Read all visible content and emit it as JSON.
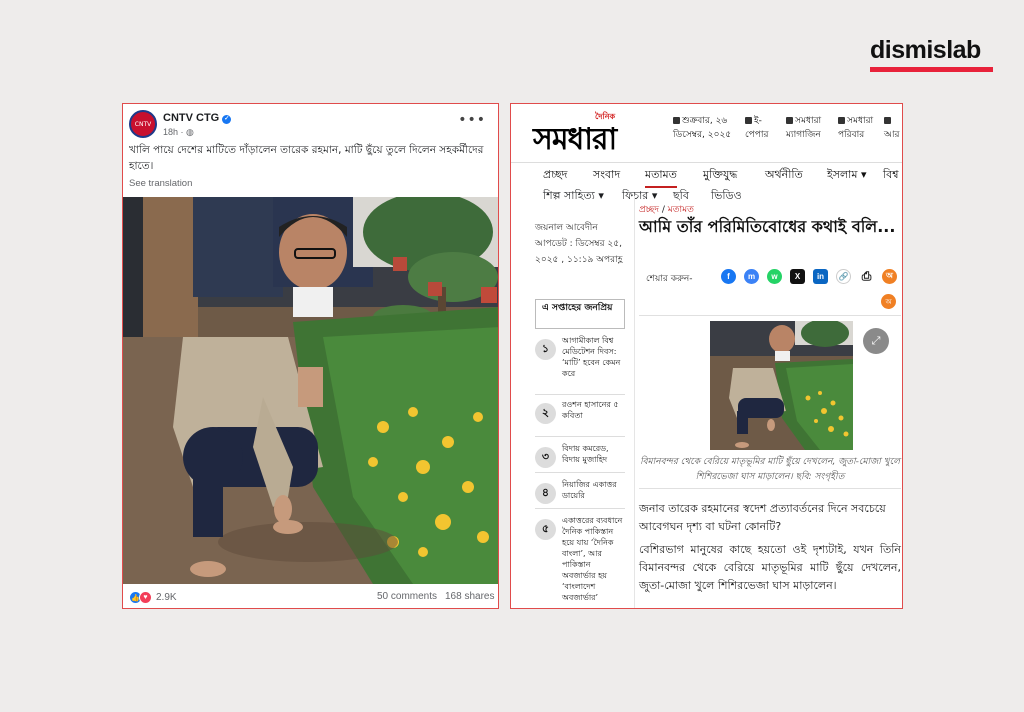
{
  "brand": {
    "name": "dismislab",
    "accent": "#e8223a"
  },
  "facebook_post": {
    "page_name": "CNTV CTG",
    "avatar_text": "CNTV",
    "verified": true,
    "time": "18h · ",
    "more": "•••",
    "text": "খালি পায়ে দেশের মাটিতে দাঁড়ালেন তারেক রহমান, মাটি ছুঁয়ে তুলে দিলেন সহকর্মীদের হাতে।",
    "see_translation": "See translation",
    "reactions": "2.9K",
    "comments": "50 comments",
    "shares": "168 shares"
  },
  "news_site": {
    "logo_tag": "দৈনিক",
    "logo": "সমধারা",
    "top_nav": [
      {
        "icon": "calendar-icon",
        "label": "শুক্রবার, ২৬ ডিসেম্বর, ২০২৫"
      },
      {
        "icon": "epaper-icon",
        "label": "ই-পেপার"
      },
      {
        "icon": "magazine-icon",
        "label": "সমধারা ম্যাগাজিন"
      },
      {
        "icon": "family-icon",
        "label": "সমধারা পরিবার"
      },
      {
        "icon": "more-icon",
        "label": "আর"
      }
    ],
    "main_nav": [
      "প্রচ্ছদ",
      "সংবাদ",
      "মতামত",
      "মুক্তিযুদ্ধ",
      "অর্থনীতি",
      "ইসলাম ▾",
      "বিশ্ব"
    ],
    "sub_nav": [
      "শিল্প সাহিত্য ▾",
      "ফিচার ▾",
      "ছবি",
      "ভিডিও"
    ],
    "breadcrumb": {
      "home": "প্রচ্ছদ",
      "sep": " / ",
      "section": "মতামত"
    },
    "author": "জয়নাল আবেদীন",
    "updated": "আপডেট : ডিসেম্বর ২৫, ২০২৫ , ১১:১৯ অপরাহ্ণ",
    "headline": "আমি তাঁর পরিমিতিবোধের কথাই বলি...",
    "share_label": "শেয়ার করুন-",
    "share_icons": [
      {
        "name": "facebook-icon",
        "glyph": "f",
        "color": "#1877f2"
      },
      {
        "name": "messenger-icon",
        "glyph": "m",
        "color": "#3b82f6"
      },
      {
        "name": "whatsapp-icon",
        "glyph": "w",
        "color": "#25d366"
      },
      {
        "name": "x-icon",
        "glyph": "X",
        "color": "#111111"
      },
      {
        "name": "linkedin-icon",
        "glyph": "in",
        "color": "#0a66c2"
      },
      {
        "name": "link-icon",
        "glyph": "🔗",
        "color": "#666666"
      },
      {
        "name": "print-icon",
        "glyph": "⎙",
        "color": "#333333"
      },
      {
        "name": "font-size-icon",
        "glyph": "অ",
        "color": "#f08024"
      }
    ],
    "share_extra": "অ",
    "expand_icon": "⤢",
    "caption": "বিমানবন্দর থেকে বেরিয়ে মাতৃভূমির মাটি ছুঁয়ে দেখলেন, জুতা-মোজা খুলে শিশিরভেজা ঘাস মাড়ালেন। ছবি: সংগৃহীত",
    "para1": "জনাব তারেক রহমানের স্বদেশ প্রত্যাবর্তনের দিনে সবচেয়ে আবেগঘন দৃশ্য বা ঘটনা কোনটি?",
    "para2": "বেশিরভাগ মানুষের কাছে হয়তো ওই দৃশ্যটাই, যখন তিনি বিমানবন্দর থেকে বেরিয়ে মাতৃভূমির মাটি ছুঁয়ে দেখলেন, জুতা-মোজা খুলে শিশিরভেজা ঘাস মাড়ালেন।",
    "popular_title": "এ সপ্তাহের জনপ্রিয়",
    "popular": [
      {
        "num": "১",
        "text": "আগামীকাল বিশ্ব মেডিটেশন দিবস: ‘মাটি’ হবেন কেমন করে"
      },
      {
        "num": "২",
        "text": "রওশন হাসানের ৫ কবিতা"
      },
      {
        "num": "৩",
        "text": "বিদায় কমরেড, বিদায় মুজাহিদ"
      },
      {
        "num": "৪",
        "text": "নিয়াজির একাত্তর ডায়েরি"
      },
      {
        "num": "৫",
        "text": "একাত্তরের ব্যবধানে দৈনিক পাকিস্তান হয়ে যায় ‘দৈনিক বাংলা’, আর পাকিস্তান অবজার্ভার হয় ‘বাংলাদেশ অবজার্ভার’"
      }
    ]
  }
}
